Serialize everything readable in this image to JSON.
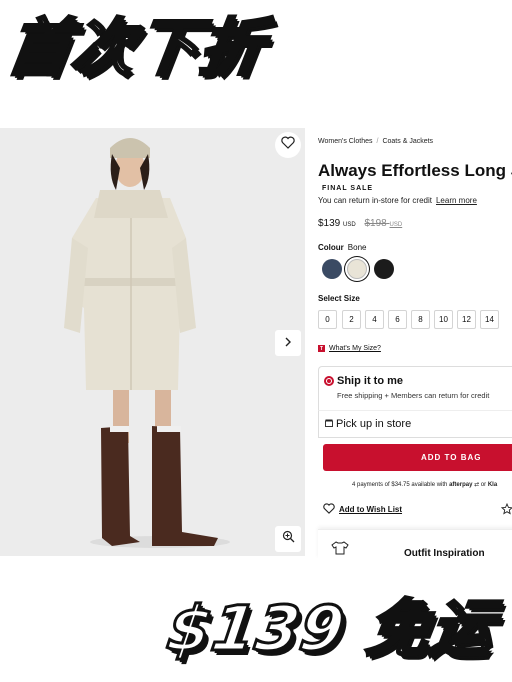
{
  "overlay": {
    "title": "首次下折",
    "price_banner": "$139 免运"
  },
  "breadcrumb": {
    "items": [
      "Women's Clothes",
      "Coats & Jackets"
    ],
    "separator": "/"
  },
  "product": {
    "title": "Always Effortless Long Ja",
    "final_sale": "FINAL SALE",
    "return_note": "You can return in-store for credit",
    "learn_more": "Learn more",
    "price": "$139",
    "currency": "USD",
    "old_price": "$198",
    "old_currency": "USD",
    "colour_label": "Colour",
    "colour_value": "Bone",
    "swatches": [
      {
        "name": "navy",
        "color": "#3a4a63"
      },
      {
        "name": "bone",
        "color": "#e9e4d7",
        "selected": true
      },
      {
        "name": "black",
        "color": "#1b1b1b"
      }
    ],
    "size_label": "Select Size",
    "sizes": [
      "0",
      "2",
      "4",
      "6",
      "8",
      "10",
      "12",
      "14"
    ],
    "whats_my_size": "What's My Size?"
  },
  "shipping": {
    "ship_title": "Ship it to me",
    "ship_sub": "Free shipping + Members can return for credit",
    "pickup": "Pick up in store"
  },
  "cta": {
    "add_to_bag": "ADD TO BAG",
    "payments_prefix": "4 payments of $34.75 available with",
    "afterpay": "afterpay",
    "or": "or",
    "klarna": "Kla"
  },
  "wishlist": {
    "label": "Add to Wish List"
  },
  "outfit": {
    "label": "Outfit Inspiration"
  },
  "colors": {
    "accent": "#c8102e",
    "photo_bg": "#ececec"
  }
}
